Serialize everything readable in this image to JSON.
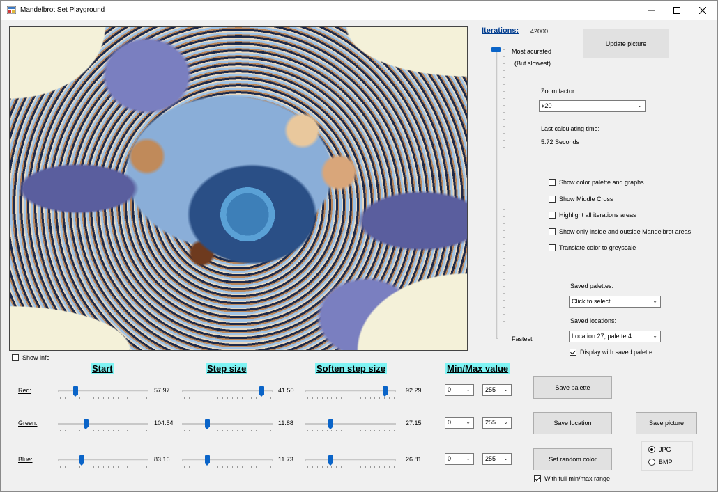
{
  "window": {
    "title": "Mandelbrot Set Playground",
    "icons": {
      "app": "mandelbrot-app-icon",
      "minimize": "minimize-icon",
      "maximize": "maximize-icon",
      "close": "close-icon"
    }
  },
  "image": {
    "show_info_label": "Show info",
    "show_info_checked": false
  },
  "iterations": {
    "label": "Iterations:",
    "value": "42000",
    "slider_top_label_1": "Most acurated",
    "slider_top_label_2": "(But slowest)",
    "slider_bottom_label": "Fastest"
  },
  "update_button": "Update picture",
  "zoom": {
    "label": "Zoom factor:",
    "value": "x20"
  },
  "timing": {
    "label": "Last calculating time:",
    "value": "5.72 Seconds"
  },
  "options": [
    {
      "label": "Show color palette and graphs",
      "checked": false
    },
    {
      "label": "Show Middle Cross",
      "checked": false
    },
    {
      "label": "Highlight all iterations areas",
      "checked": false
    },
    {
      "label": "Show only inside and outside Mandelbrot areas",
      "checked": false
    },
    {
      "label": "Translate color to greyscale",
      "checked": false
    }
  ],
  "saved_palettes": {
    "label": "Saved palettes:",
    "value": "Click to select"
  },
  "saved_locations": {
    "label": "Saved locations:",
    "value": "Location 27, palette 4"
  },
  "display_saved_palette": {
    "label": "Display with saved palette",
    "checked": true
  },
  "headers": {
    "start": "Start",
    "step": "Step size",
    "soften": "Soften step size",
    "minmax": "Min/Max value"
  },
  "channels": [
    {
      "label": "Red:",
      "start": "57.97",
      "step": "41.50",
      "soften": "92.29",
      "min": "0",
      "max": "255",
      "start_level": 0.18,
      "step_level": 0.9,
      "soften_level": 0.9
    },
    {
      "label": "Green:",
      "start": "104.54",
      "step": "11.88",
      "soften": "27.15",
      "min": "0",
      "max": "255",
      "start_level": 0.3,
      "step_level": 0.27,
      "soften_level": 0.27
    },
    {
      "label": "Blue:",
      "start": "83.16",
      "step": "11.73",
      "soften": "26.81",
      "min": "0",
      "max": "255",
      "start_level": 0.25,
      "step_level": 0.27,
      "soften_level": 0.27
    }
  ],
  "buttons": {
    "save_palette": "Save  palette",
    "save_location": "Save location",
    "save_picture": "Save picture",
    "random_color": "Set random color"
  },
  "full_range": {
    "label": "With full min/max range",
    "checked": true
  },
  "format": {
    "jpg": "JPG",
    "bmp": "BMP",
    "selected": "JPG"
  },
  "colors": {
    "header_bg": "#7ff3f3",
    "slider_thumb": "#0a64c8",
    "window_bg": "#f0f0f0"
  }
}
